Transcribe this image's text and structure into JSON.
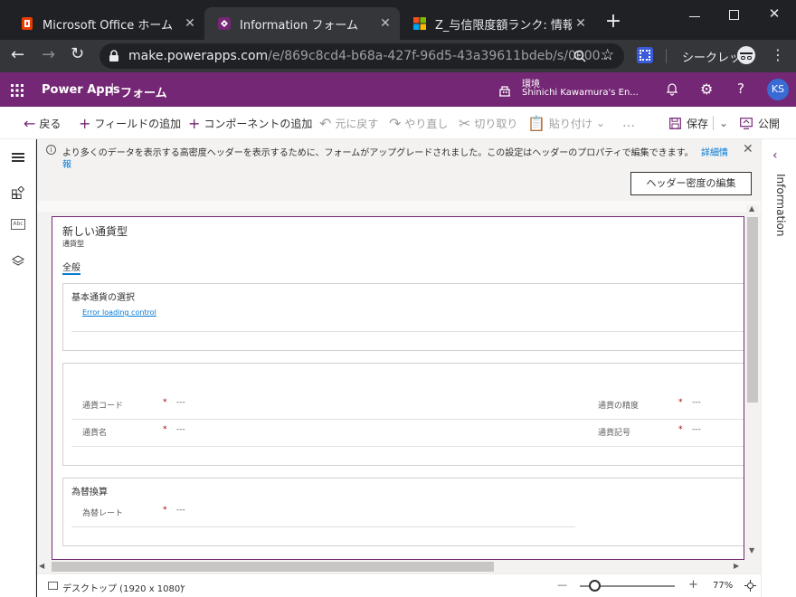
{
  "browser": {
    "tabs": [
      {
        "title": "Microsoft Office ホーム",
        "icon": "office-icon"
      },
      {
        "title": "Information フォーム",
        "icon": "powerapps-icon"
      },
      {
        "title": "Z_与信限度額ランク: 情報（全",
        "icon": "microsoft-icon"
      }
    ],
    "new_tab": "+",
    "url_host": "make.powerapps.com",
    "url_path": "/e/869c8cd4-b68a-427f-96d5-43a39611bdeb/s/0000...",
    "incognito_label": "シークレット"
  },
  "app": {
    "name": "Power Apps",
    "separator": "|",
    "section": "フォーム",
    "env_label": "環境",
    "env_name": "Shinichi Kawamura's En...",
    "avatar": "KS",
    "help": "?"
  },
  "commands": {
    "back": "戻る",
    "add_field": "フィールドの追加",
    "add_component": "コンポーネントの追加",
    "undo": "元に戻す",
    "redo": "やり直し",
    "cut": "切り取り",
    "paste": "貼り付け",
    "more": "…",
    "save": "保存",
    "publish": "公開"
  },
  "notice": {
    "text": "より多くのデータを表示する高密度ヘッダーを表示するために、フォームがアップグレードされました。この設定はヘッダーのプロパティで編集できます。",
    "link_part1": "詳細情",
    "link_part2": "報"
  },
  "header_button": "ヘッダー密度の編集",
  "right_panel_title": "Information",
  "form": {
    "title": "新しい通貨型",
    "subtitle": "通貨型",
    "tab": "全般",
    "section1": {
      "title": "基本通貨の選択",
      "error": "Error loading control"
    },
    "section2": {
      "fields": [
        {
          "label": "通貨コード",
          "req": "*",
          "value": "---"
        },
        {
          "label": "通貨名",
          "req": "*",
          "value": "---"
        },
        {
          "label": "通貨の精度",
          "req": "*",
          "value": "---"
        },
        {
          "label": "通貨記号",
          "req": "*",
          "value": "---"
        }
      ]
    },
    "section3": {
      "title": "為替換算",
      "field_label": "為替レート",
      "req": "*",
      "value": "---"
    }
  },
  "status": {
    "device": "デスクトップ (1920 x 1080)",
    "zoom": "77%",
    "minus": "—",
    "plus": "+"
  },
  "colors": {
    "brand": "#742774",
    "link": "#0078d4",
    "required": "#a80000"
  }
}
